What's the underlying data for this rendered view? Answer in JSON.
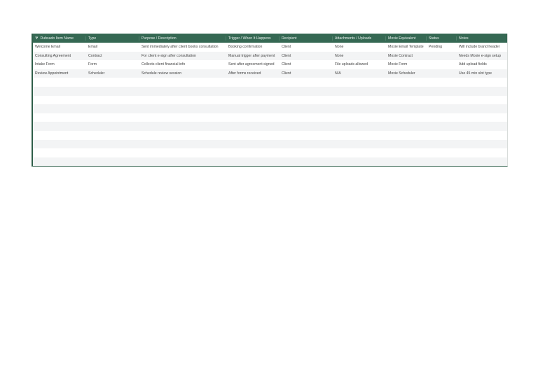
{
  "columns": [
    "Dubsado Item Name",
    "Type",
    "Purpose / Description",
    "Trigger / When It Happens",
    "Recipient",
    "Attachments / Uploads",
    "Moxie Equivalent",
    "Status",
    "Notes"
  ],
  "rows": [
    [
      "Welcome Email",
      "Email",
      "Sent immediately after client books consultation",
      "Booking confirmation",
      "Client",
      "None",
      "Moxie Email Template",
      "Pending",
      "Will include brand header"
    ],
    [
      "Consulting Agreement",
      "Contract",
      "For client e-sign after consultation",
      "Manual trigger after payment",
      "Client",
      "None",
      "Moxie Contract",
      "",
      "Needs Moxie e-sign setup"
    ],
    [
      "Intake Form",
      "Form",
      "Collects client financial info",
      "Sent after agreement signed",
      "Client",
      "File uploads allowed",
      "Moxie Form",
      "",
      "Add upload fields"
    ],
    [
      "Review Appointment",
      "Scheduler",
      "Schedule review session",
      "After forms received",
      "Client",
      "N/A",
      "Moxie Scheduler",
      "",
      "Use 45 min slot type"
    ]
  ],
  "empty_row_count": 10,
  "colors": {
    "header": "#356853",
    "alt_row": "#f3f4f5"
  }
}
